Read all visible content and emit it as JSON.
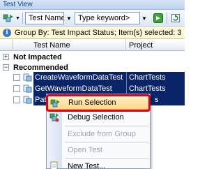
{
  "window": {
    "title": "Test View"
  },
  "toolbar": {
    "group_by_value": "Test Name",
    "filter_placeholder": "Type keyword>",
    "colors": {
      "run_green": "#2e9b2e",
      "apply_green": "#3aa43a"
    }
  },
  "infobar": {
    "text": "Group By: Test Impact Status; Item(s) selected: 3"
  },
  "columns": [
    {
      "label": "Test Name"
    },
    {
      "label": "Project"
    }
  ],
  "groups": [
    {
      "label": "Not Impacted",
      "expander": "+"
    },
    {
      "label": "Recommended",
      "expander": "−"
    }
  ],
  "rows": [
    {
      "name": "CreateWaveformDataTest",
      "project": "ChartTests"
    },
    {
      "name": "GetWaveformDataTest",
      "project": "ChartTests"
    },
    {
      "name": "Pati",
      "project": "s"
    }
  ],
  "context_menu": {
    "items": [
      {
        "label": "Run Selection",
        "icon": "run-icon",
        "enabled": true
      },
      {
        "label": "Debug Selection",
        "icon": "debug-icon",
        "enabled": true
      },
      {
        "label": "Exclude from Group",
        "icon": "",
        "enabled": false
      },
      {
        "label": "Open Test",
        "icon": "",
        "enabled": false
      },
      {
        "label": "New Test...",
        "icon": "new-test-icon",
        "enabled": true
      }
    ]
  },
  "colors": {
    "selection": "#0a246a",
    "highlight_frame": "#e0001b",
    "info_background": "#fff8d8"
  }
}
